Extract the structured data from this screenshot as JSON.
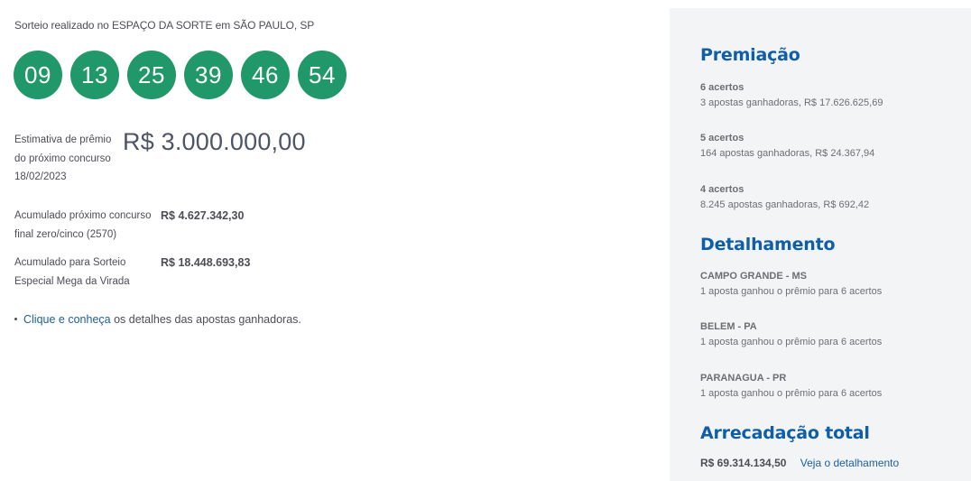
{
  "draw": {
    "location_text": "Sorteio realizado no ESPAÇO DA SORTE em SÃO PAULO, SP",
    "numbers": [
      "09",
      "13",
      "25",
      "39",
      "46",
      "54"
    ],
    "ball_color": "#209869"
  },
  "estimate": {
    "label_line1": "Estimativa de prêmio",
    "label_line2": "do próximo concurso",
    "label_line3": "18/02/2023",
    "value": "R$ 3.000.000,00"
  },
  "accumulated": [
    {
      "label_line1": "Acumulado próximo concurso",
      "label_line2": "final zero/cinco (2570)",
      "value": "R$ 4.627.342,30"
    },
    {
      "label_line1": "Acumulado para Sorteio",
      "label_line2": "Especial Mega da Virada",
      "value": "R$ 18.448.693,83"
    }
  ],
  "winners_link": {
    "link_text": "Clique e conheça",
    "rest_text": " os detalhes das apostas ganhadoras."
  },
  "sidebar": {
    "premiacao_title": "Premiação",
    "premiacao": [
      {
        "title": "6 acertos",
        "desc": "3 apostas ganhadoras, R$ 17.626.625,69"
      },
      {
        "title": "5 acertos",
        "desc": "164 apostas ganhadoras, R$ 24.367,94"
      },
      {
        "title": "4 acertos",
        "desc": "8.245 apostas ganhadoras, R$ 692,42"
      }
    ],
    "detalhamento_title": "Detalhamento",
    "detalhamento": [
      {
        "title": "CAMPO GRANDE - MS",
        "desc": "1 aposta ganhou o prêmio para 6 acertos"
      },
      {
        "title": "BELEM - PA",
        "desc": "1 aposta ganhou o prêmio para 6 acertos"
      },
      {
        "title": "PARANAGUA - PR",
        "desc": "1 aposta ganhou o prêmio para 6 acertos"
      }
    ],
    "arrecadacao_title": "Arrecadação total",
    "arrecadacao_value": "R$ 69.314.134,50",
    "arrecadacao_link": "Veja o detalhamento",
    "heading_color": "#0f5ea8",
    "background_color": "#f3f4f6"
  }
}
